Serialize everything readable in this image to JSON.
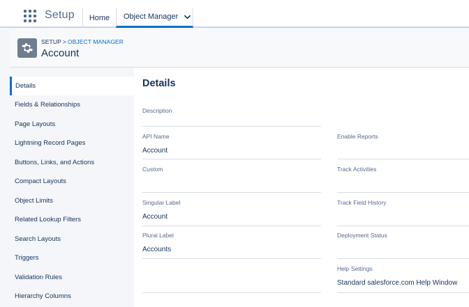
{
  "topnav": {
    "app_name": "Setup",
    "tabs": [
      {
        "label": "Home"
      },
      {
        "label": "Object Manager"
      }
    ]
  },
  "header": {
    "breadcrumb": {
      "setup": "SETUP",
      "object_manager": "OBJECT MANAGER"
    },
    "title": "Account"
  },
  "sidebar": {
    "items": [
      {
        "label": "Details",
        "active": true
      },
      {
        "label": "Fields & Relationships"
      },
      {
        "label": "Page Layouts"
      },
      {
        "label": "Lightning Record Pages"
      },
      {
        "label": "Buttons, Links, and Actions"
      },
      {
        "label": "Compact Layouts"
      },
      {
        "label": "Object Limits"
      },
      {
        "label": "Related Lookup Filters"
      },
      {
        "label": "Search Layouts"
      },
      {
        "label": "Triggers"
      },
      {
        "label": "Validation Rules"
      },
      {
        "label": "Hierarchy Columns"
      }
    ]
  },
  "main": {
    "section_title": "Details",
    "left_fields": [
      {
        "label": "Description",
        "value": ""
      },
      {
        "label": "API Name",
        "value": "Account"
      },
      {
        "label": "Custom",
        "value": ""
      },
      {
        "label": "Singular Label",
        "value": "Account"
      },
      {
        "label": "Plural Label",
        "value": "Accounts"
      }
    ],
    "right_fields": [
      {
        "label": "Enable Reports",
        "value": ""
      },
      {
        "label": "Track Activities",
        "value": ""
      },
      {
        "label": "Track Field History",
        "value": ""
      },
      {
        "label": "Deployment Status",
        "value": ""
      },
      {
        "label": "Help Settings",
        "value": "Standard salesforce.com Help Window"
      }
    ]
  },
  "colors": {
    "accent": "#0070d2",
    "text": "#16325c",
    "muted": "#54698d",
    "background": "#f4f6f9"
  },
  "icons": {
    "app_launcher": "app-launcher-icon",
    "dropdown": "chevron-down-icon",
    "header": "gear-icon"
  }
}
